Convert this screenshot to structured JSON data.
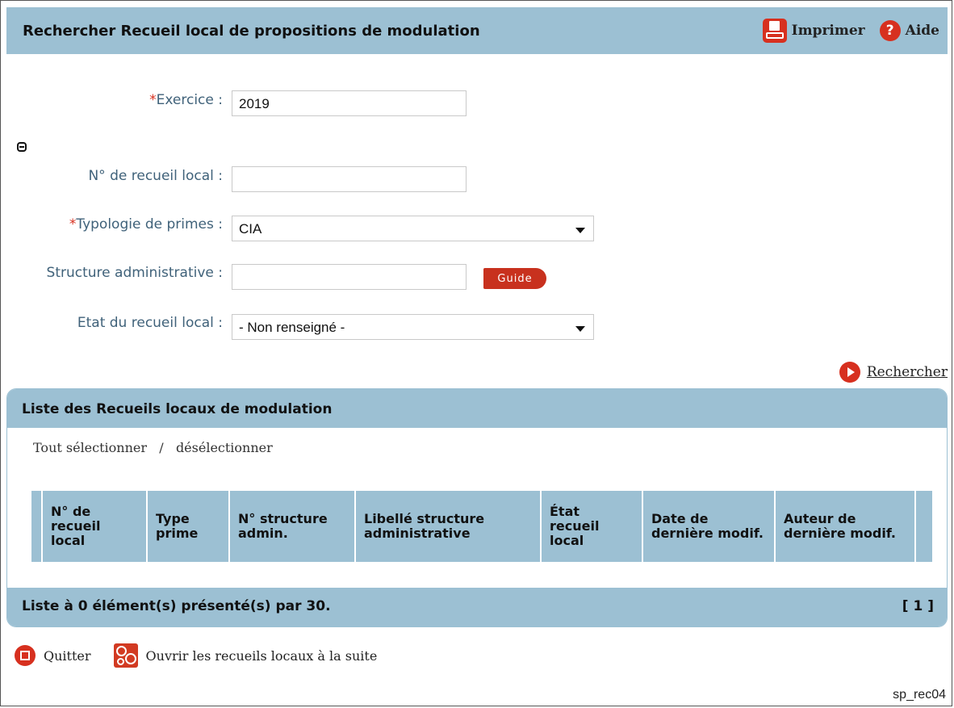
{
  "header": {
    "title": "Rechercher Recueil local de propositions de modulation",
    "print_label": "Imprimer",
    "help_label": "Aide",
    "help_glyph": "?"
  },
  "form": {
    "required_marker": "*",
    "exercice": {
      "label": "Exercice :",
      "value": "2019"
    },
    "num_recueil": {
      "label": "N° de recueil local :",
      "value": ""
    },
    "typologie": {
      "label": "Typologie de primes :",
      "value": "CIA"
    },
    "structure": {
      "label": "Structure administrative :",
      "value": "",
      "guide_label": "Guide"
    },
    "etat": {
      "label": "Etat du recueil local :",
      "value": "- Non renseigné -"
    }
  },
  "search_label": "Rechercher",
  "list": {
    "title": "Liste des Recueils locaux de modulation",
    "select_all": "Tout sélectionner",
    "separator": "/",
    "deselect": "désélectionner",
    "columns": [
      "N° de recueil local",
      "Type prime",
      "N° structure admin.",
      "Libellé structure administrative",
      "État recueil local",
      "Date de dernière modif.",
      "Auteur de dernière modif."
    ],
    "footer_text": "Liste à 0 élément(s) présenté(s) par 30.",
    "pagination": "[ 1 ]"
  },
  "actions": {
    "quit": "Quitter",
    "open_next": "Ouvrir les recueils locaux à la suite"
  },
  "screen_code": "sp_rec04",
  "colors": {
    "header_bg": "#9cc0d3",
    "accent": "#d7301f",
    "label": "#40627a"
  }
}
